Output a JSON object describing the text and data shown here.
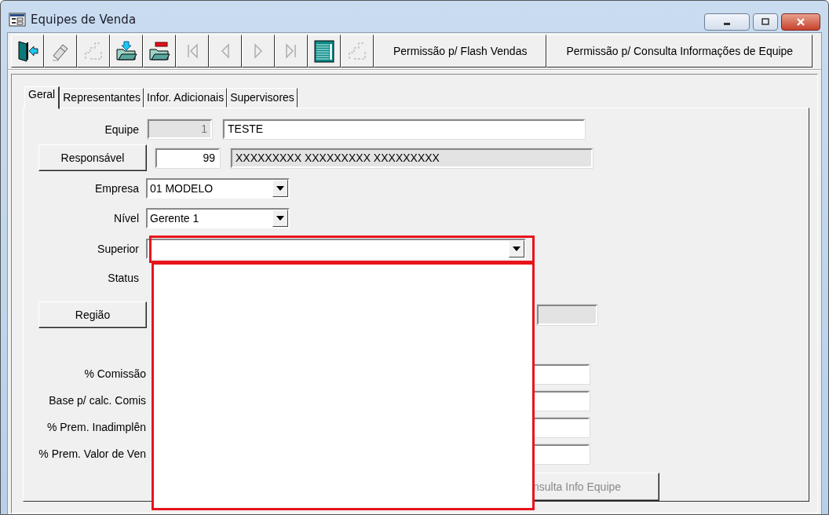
{
  "window": {
    "title": "Equipes de Venda"
  },
  "toolbar": [
    {
      "kind": "exit",
      "disabled": false
    },
    {
      "kind": "eraser",
      "disabled": false
    },
    {
      "kind": "steps",
      "disabled": true
    },
    {
      "kind": "folder-in",
      "disabled": false
    },
    {
      "kind": "folder-remove",
      "disabled": false
    },
    {
      "kind": "first",
      "disabled": true
    },
    {
      "kind": "prev",
      "disabled": true
    },
    {
      "kind": "next",
      "disabled": true
    },
    {
      "kind": "last",
      "disabled": true
    },
    {
      "kind": "grid",
      "disabled": false
    },
    {
      "kind": "steps",
      "disabled": true
    }
  ],
  "toolbar_buttons": [
    {
      "label": "Permissão p/ Flash Vendas"
    },
    {
      "label": "Permissão p/ Consulta Informações de Equipe"
    }
  ],
  "tabs": [
    {
      "label": "Geral",
      "selected": true
    },
    {
      "label": "Representantes",
      "selected": false
    },
    {
      "label": "Infor. Adicionais",
      "selected": false
    },
    {
      "label": "Supervisores",
      "selected": false
    }
  ],
  "form": {
    "equipe": {
      "label": "Equipe",
      "code": "1",
      "name": "TESTE"
    },
    "responsavel": {
      "button": "Responsável",
      "code": "99",
      "name": "XXXXXXXXX XXXXXXXXX XXXXXXXXX"
    },
    "empresa": {
      "label": "Empresa",
      "value": "01 MODELO"
    },
    "nivel": {
      "label": "Nível",
      "value": "Gerente 1"
    },
    "superior": {
      "label": "Superior",
      "expanded": true
    },
    "status": {
      "label": "Status"
    },
    "regiao": {
      "button": "Região"
    },
    "percent_fields": [
      {
        "label": "% Comissão"
      },
      {
        "label": "Base p/ calc. Comis"
      },
      {
        "label": "% Prem. Inadimplên"
      },
      {
        "label": "% Prem. Valor de Ven"
      }
    ],
    "consulta_button": {
      "label": "nsulta Info Equipe",
      "disabled": true
    }
  }
}
